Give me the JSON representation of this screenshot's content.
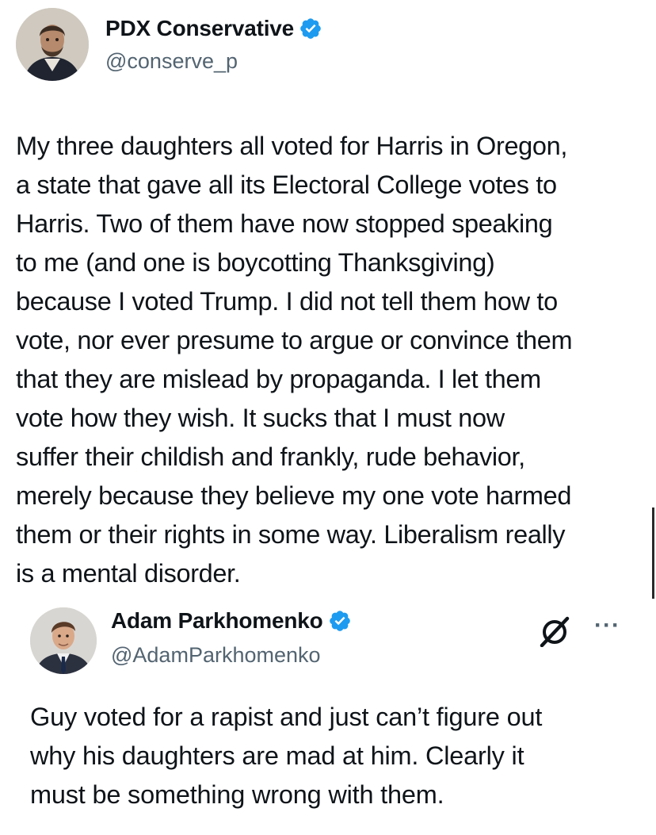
{
  "top_tweet": {
    "display_name": "PDX Conservative",
    "handle": "@conserve_p",
    "verified": true,
    "text": "My three daughters all voted for Harris in Oregon,\na state that gave all its Electoral College votes to\nHarris. Two of them have now stopped speaking\nto me (and one is boycotting Thanksgiving)\nbecause I voted Trump. I did not tell them how to\nvote, nor ever presume to argue or convince them\nthat they are mislead by propaganda. I let them\nvote how they wish. It sucks that I must now\nsuffer their childish and frankly, rude behavior,\nmerely because they believe my one vote harmed\nthem or their rights in some way. Liberalism really\nis a mental disorder."
  },
  "reply_tweet": {
    "display_name": "Adam Parkhomenko",
    "handle": "@AdamParkhomenko",
    "verified": true,
    "text": "Guy voted for a rapist and just can’t figure out\nwhy his daughters are mad at him. Clearly it\nmust be something wrong with them.",
    "icons": [
      "grok-icon",
      "more-options-icon"
    ]
  },
  "colors": {
    "verified_blue": "#1d9bf0",
    "text": "#0f1419",
    "secondary_text": "#536471"
  }
}
